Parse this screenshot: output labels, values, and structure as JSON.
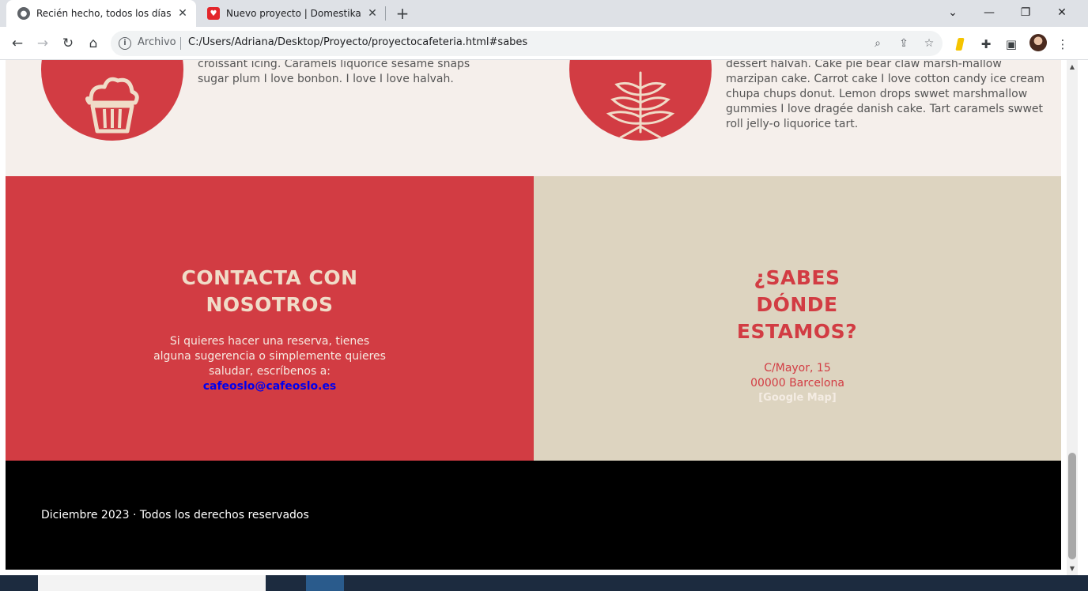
{
  "browser": {
    "tabs": [
      {
        "title": "Recién hecho, todos los días",
        "active": true
      },
      {
        "title": "Nuevo proyecto | Domestika",
        "active": false
      }
    ],
    "address": {
      "chip": "Archivo",
      "url": "C:/Users/Adriana/Desktop/Proyecto/proyectocafeteria.html#sabes"
    }
  },
  "features": {
    "left_text": "croissant icing. Caramels liquorice sesame snaps sugar plum I love bonbon. I love I love halvah.",
    "right_text": "dessert halvah. Cake pie bear claw marsh-mallow marzipan cake. Carrot cake I love cotton candy ice cream chupa chups donut. Lemon drops swwet marshmallow gummies I love dragée danish cake. Tart caramels swwet roll jelly-o liquorice tart.",
    "left_icon": "cupcake-icon",
    "right_icon": "wheat-icon"
  },
  "contact": {
    "heading_line1": "CONTACTA CON",
    "heading_line2": "NOSOTROS",
    "text": "Si quieres hacer una reserva, tienes alguna sugerencia o simplemente quieres saludar, escríbenos a:",
    "email": "cafeoslo@cafeoslo.es"
  },
  "location": {
    "heading_line1": "¿SABES",
    "heading_line2": "DÓNDE",
    "heading_line3": "ESTAMOS?",
    "street": "C/Mayor, 15",
    "city": "00000 Barcelona",
    "map_link": "[Google Map]"
  },
  "footer": {
    "text": "Diciembre 2023 · Todos los derechos reservados"
  },
  "colors": {
    "brand_red": "#d23c43",
    "beige": "#ddd4c0",
    "cream": "#f5efeb"
  }
}
